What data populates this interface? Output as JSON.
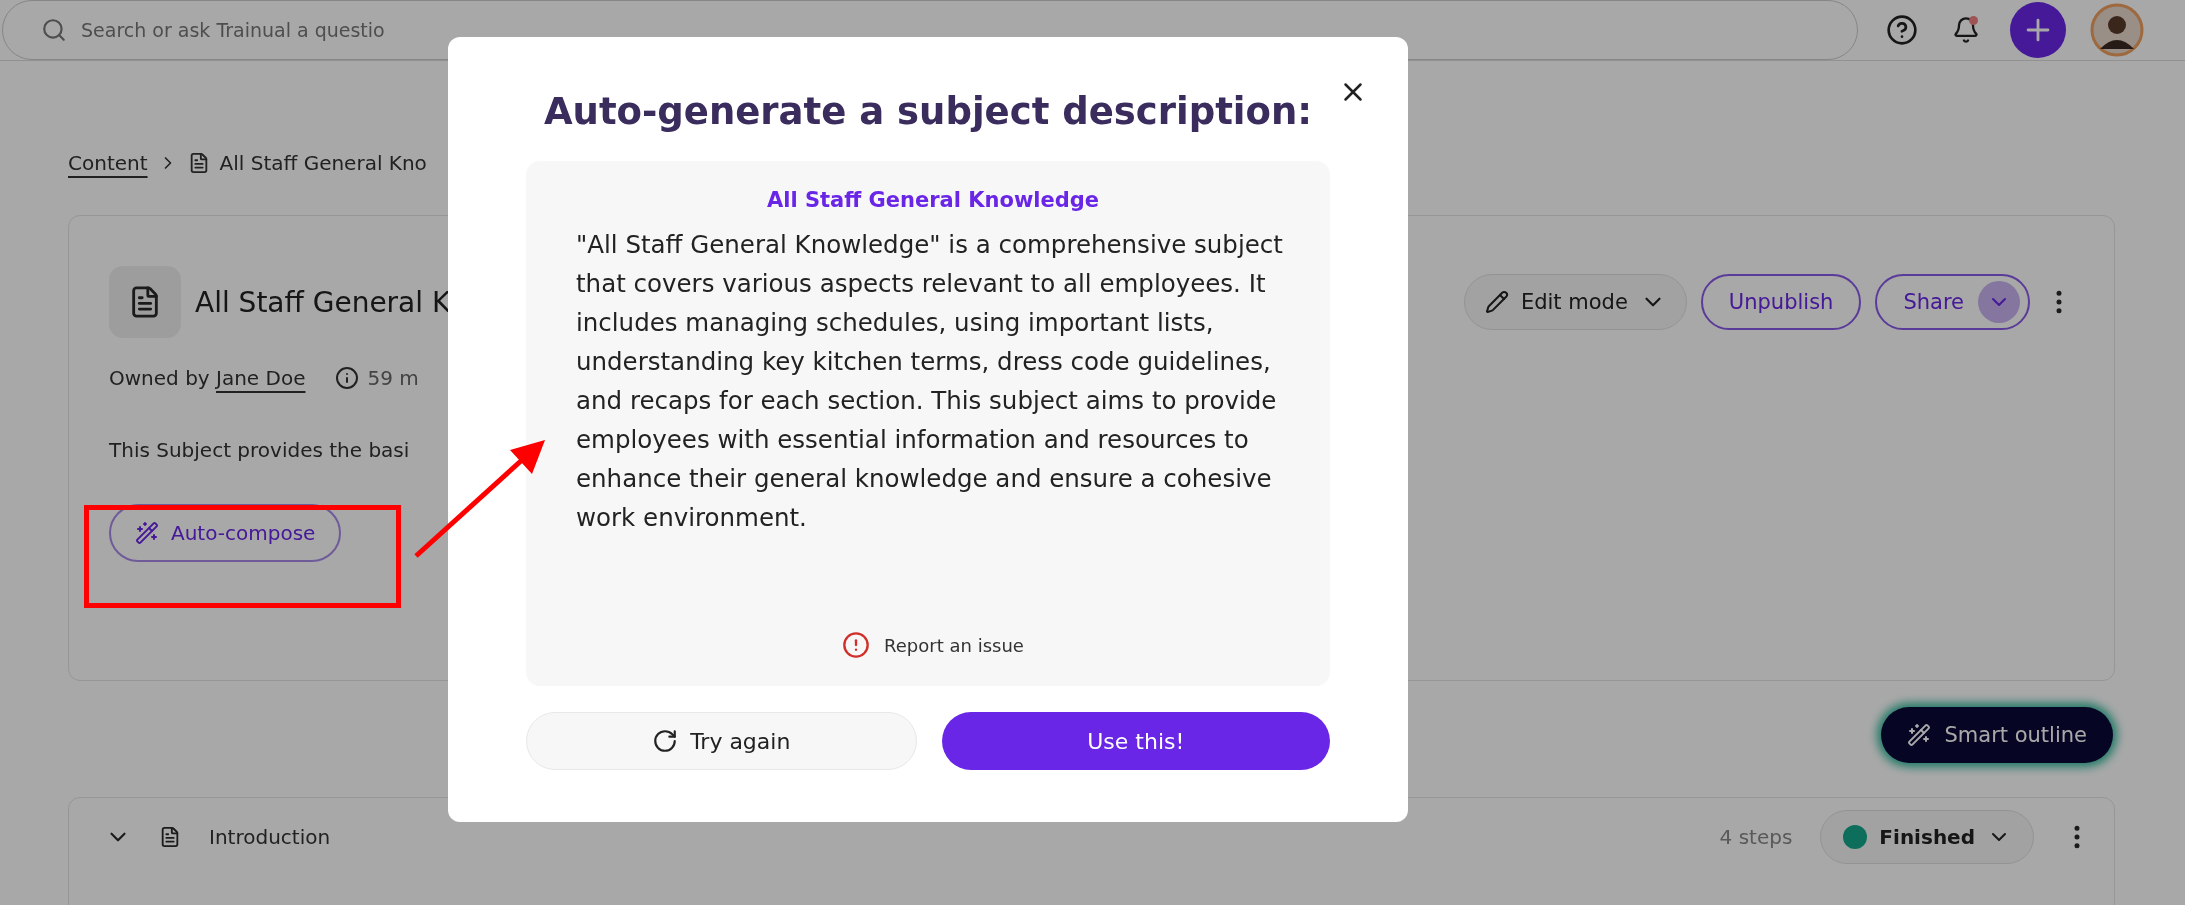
{
  "top_bar": {
    "search": {
      "placeholder": "Search or ask Trainual a questio"
    },
    "notification_unread": true
  },
  "breadcrumb": {
    "root": "Content",
    "current": "All Staff General Kno"
  },
  "subject": {
    "title": "All Staff General K",
    "owner_label": "Owned by",
    "owner": "Jane Doe",
    "duration": "59 m",
    "description": "This Subject provides the basi",
    "auto_compose": "Auto-compose",
    "edit_mode": "Edit mode",
    "unpublish": "Unpublish",
    "share": "Share"
  },
  "smart_outline": "Smart outline",
  "sections": [
    {
      "title": "Introduction",
      "steps": "4 steps",
      "status": "Finished",
      "expanded": false
    }
  ],
  "modal": {
    "title": "Auto-generate a subject description:",
    "subject_name": "All Staff General Knowledge",
    "description": "\"All Staff General Knowledge\" is a comprehensive subject that covers various aspects relevant to all employees. It includes managing schedules, using important lists, understanding key kitchen terms, dress code guidelines, and recaps for each section. This subject aims to provide employees with essential information and resources to enhance their general knowledge and ensure a cohesive work environment.",
    "report": "Report an issue",
    "try_again": "Try again",
    "use": "Use this!"
  }
}
